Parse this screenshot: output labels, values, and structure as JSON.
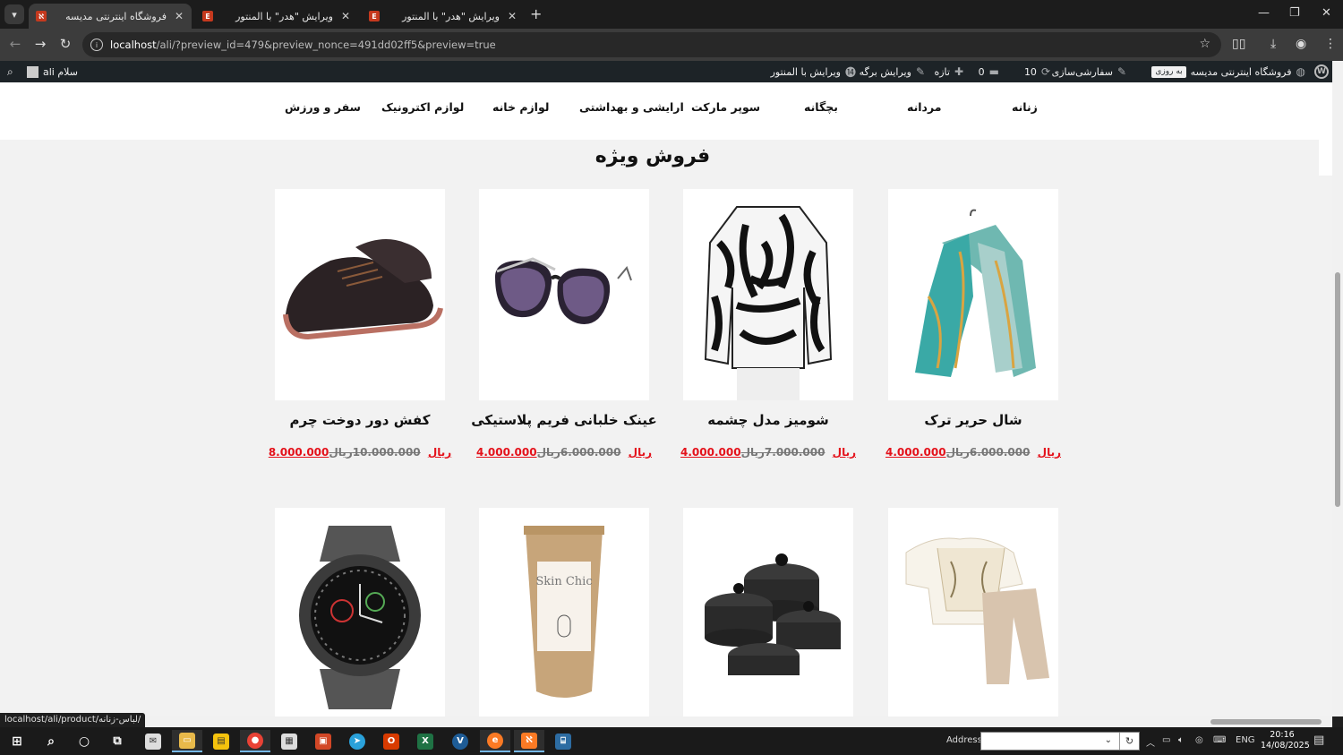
{
  "browser": {
    "tabs": [
      {
        "title": "فروشگاه اینترنتی مدیسه",
        "active": true
      },
      {
        "title": "ویرایش \"هدر\" با المنتور",
        "active": false
      },
      {
        "title": "ویرایش \"هدر\" با المنتور",
        "active": false
      }
    ],
    "url_host": "localhost",
    "url_rest": "/ali/?preview_id=479&preview_nonce=491dd02ff5&preview=true",
    "status_url": "localhost/ali/product/لباس-زنانه/"
  },
  "adminbar": {
    "site_name": "فروشگاه اینترنتی مدیسه",
    "pill": "به روزی",
    "customize": "سفارشی‌سازی",
    "updates": "10",
    "comments": "0",
    "new": "تازه",
    "edit_page": "ویرایش برگه",
    "edit_elementor": "ویرایش با المنتور",
    "greeting": "سلام ali"
  },
  "menu": [
    "زنانه",
    "مردانه",
    "بچگانه",
    "سوپر مارکت",
    "ارایشی و بهداشتی",
    "لوازم خانه",
    "لوازم اکترونیک",
    "سفر و ورزش"
  ],
  "section_title": "فروش ویژه",
  "products": [
    {
      "name": "شال حریر ترک",
      "old_price": "6.000.000",
      "new_price": "4.000.000",
      "currency": "ریال",
      "image": "scarf"
    },
    {
      "name": "شومیز مدل چشمه",
      "old_price": "7.000.000",
      "new_price": "4.000.000",
      "currency": "ریال",
      "image": "zebra-blouse"
    },
    {
      "name": "عینک خلبانی فریم پلاستیکی",
      "old_price": "6.000.000",
      "new_price": "4.000.000",
      "currency": "ریال",
      "image": "sunglasses"
    },
    {
      "name": "کفش دور دوخت چرم",
      "old_price": "10.000.000",
      "new_price": "8.000.000",
      "currency": "ریال",
      "image": "leather-shoes"
    }
  ],
  "products_row2": [
    {
      "image": "kids-outfit"
    },
    {
      "image": "cookware-set"
    },
    {
      "image": "skin-chic-tube",
      "brand_text": "Skin Chic"
    },
    {
      "image": "smart-watch"
    }
  ],
  "taskbar": {
    "address_label": "Address",
    "lang": "ENG",
    "time": "20:16",
    "date": "14/08/2025"
  },
  "colors": {
    "sale_price": "#e4121b",
    "adminbar": "#1d2327",
    "accent": "#76b9ed"
  }
}
